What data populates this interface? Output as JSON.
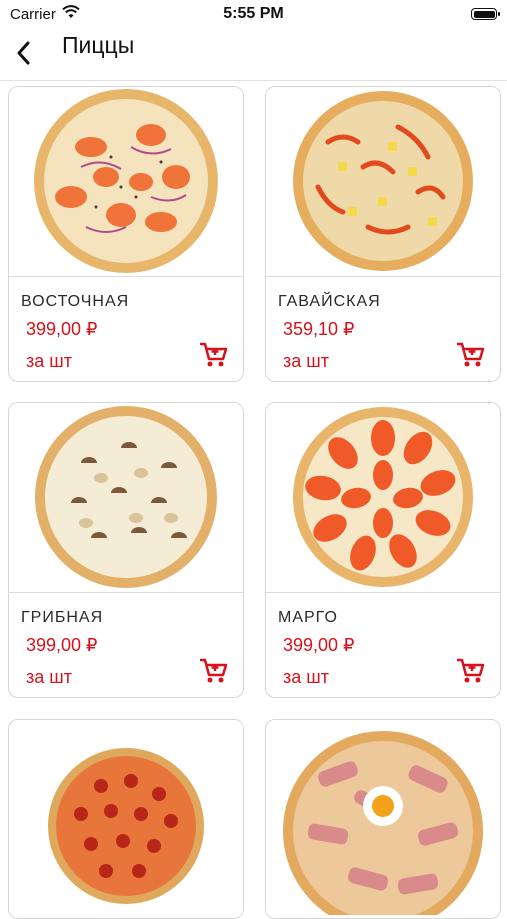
{
  "status": {
    "carrier": "Carrier",
    "time": "5:55 PM"
  },
  "nav": {
    "title": "Пиццы"
  },
  "products": [
    {
      "name": "ВОСТОЧНАЯ",
      "price": "399,00 ₽",
      "unit": "за шт"
    },
    {
      "name": "ГАВАЙСКАЯ",
      "price": "359,10 ₽",
      "unit": "за шт"
    },
    {
      "name": "ГРИБНАЯ",
      "price": "399,00 ₽",
      "unit": "за шт"
    },
    {
      "name": "МАРГО",
      "price": "399,00 ₽",
      "unit": "за шт"
    },
    {
      "name": "",
      "price": "",
      "unit": ""
    },
    {
      "name": "",
      "price": "",
      "unit": ""
    }
  ],
  "colors": {
    "accent": "#d8121c",
    "border": "#d6d6d6"
  },
  "icons": {
    "back": "chevron-left-icon",
    "cart": "shopping-cart-icon",
    "wifi": "wifi-icon",
    "battery": "battery-icon"
  }
}
